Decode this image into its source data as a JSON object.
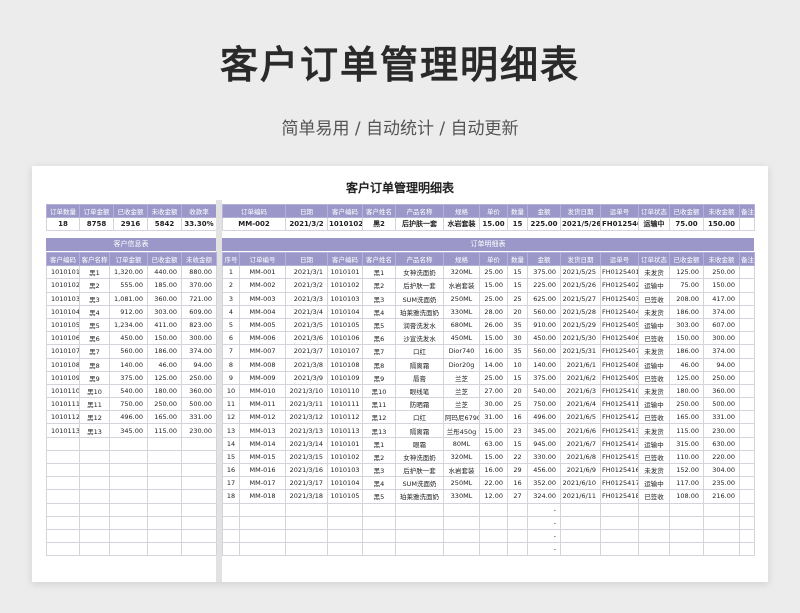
{
  "page_title": "客户订单管理明细表",
  "subtitle": "简单易用  /  自动统计  /  自动更新",
  "sheet_title": "客户订单管理明细表",
  "summary": {
    "headers": [
      "订单数量",
      "订单金额",
      "已收金额",
      "未收金额",
      "收款率"
    ],
    "values": [
      "18",
      "8758",
      "2916",
      "5842",
      "33.30%"
    ]
  },
  "search": {
    "headers": [
      "订单编码",
      "日期",
      "客户编码",
      "客户姓名",
      "产品名称",
      "规格",
      "单价",
      "数量",
      "金额",
      "发货日期",
      "运单号",
      "订单状态",
      "已收金额",
      "未收金额",
      "备注"
    ],
    "values": [
      "MM-002",
      "2021/3/2",
      "1010102",
      "黑2",
      "后护肤一套",
      "水岩套装",
      "15.00",
      "15",
      "225.00",
      "2021/5/26",
      "FH0125402",
      "运输中",
      "75.00",
      "150.00",
      ""
    ]
  },
  "customer_band": "客户信息表",
  "order_band": "订单明细表",
  "customer_headers": [
    "客户编码",
    "客户名称",
    "订单金额",
    "已收金额",
    "未收金额"
  ],
  "customers": [
    [
      "1010101",
      "黑1",
      "1,320.00",
      "440.00",
      "880.00"
    ],
    [
      "1010102",
      "黑2",
      "555.00",
      "185.00",
      "370.00"
    ],
    [
      "1010103",
      "黑3",
      "1,081.00",
      "360.00",
      "721.00"
    ],
    [
      "1010104",
      "黑4",
      "912.00",
      "303.00",
      "609.00"
    ],
    [
      "1010105",
      "黑5",
      "1,234.00",
      "411.00",
      "823.00"
    ],
    [
      "1010106",
      "黑6",
      "450.00",
      "150.00",
      "300.00"
    ],
    [
      "1010107",
      "黑7",
      "560.00",
      "186.00",
      "374.00"
    ],
    [
      "1010108",
      "黑8",
      "140.00",
      "46.00",
      "94.00"
    ],
    [
      "1010109",
      "黑9",
      "375.00",
      "125.00",
      "250.00"
    ],
    [
      "1010110",
      "黑10",
      "540.00",
      "180.00",
      "360.00"
    ],
    [
      "1010111",
      "黑11",
      "750.00",
      "250.00",
      "500.00"
    ],
    [
      "1010112",
      "黑12",
      "496.00",
      "165.00",
      "331.00"
    ],
    [
      "1010113",
      "黑13",
      "345.00",
      "115.00",
      "230.00"
    ]
  ],
  "order_headers": [
    "序号",
    "订单编号",
    "日期",
    "客户编码",
    "客户姓名",
    "产品名称",
    "规格",
    "单价",
    "数量",
    "金额",
    "发货日期",
    "运单号",
    "订单状态",
    "已收金额",
    "未收金额",
    "备注"
  ],
  "orders": [
    [
      "1",
      "MM-001",
      "2021/3/1",
      "1010101",
      "黑1",
      "女神洗面奶",
      "320ML",
      "25.00",
      "15",
      "375.00",
      "2021/5/25",
      "FH0125401",
      "未发货",
      "125.00",
      "250.00",
      ""
    ],
    [
      "2",
      "MM-002",
      "2021/3/2",
      "1010102",
      "黑2",
      "后护肤一套",
      "水岩套装",
      "15.00",
      "15",
      "225.00",
      "2021/5/26",
      "FH0125402",
      "运输中",
      "75.00",
      "150.00",
      ""
    ],
    [
      "3",
      "MM-003",
      "2021/3/3",
      "1010103",
      "黑3",
      "SUM洗面奶",
      "250ML",
      "25.00",
      "25",
      "625.00",
      "2021/5/27",
      "FH0125403",
      "已签收",
      "208.00",
      "417.00",
      ""
    ],
    [
      "4",
      "MM-004",
      "2021/3/4",
      "1010104",
      "黑4",
      "珀莱雅洗面奶",
      "330ML",
      "28.00",
      "20",
      "560.00",
      "2021/5/28",
      "FH0125404",
      "未发货",
      "186.00",
      "374.00",
      ""
    ],
    [
      "5",
      "MM-005",
      "2021/3/5",
      "1010105",
      "黑5",
      "润膏洗发水",
      "680ML",
      "26.00",
      "35",
      "910.00",
      "2021/5/29",
      "FH0125405",
      "运输中",
      "303.00",
      "607.00",
      ""
    ],
    [
      "6",
      "MM-006",
      "2021/3/6",
      "1010106",
      "黑6",
      "沙宣洗发水",
      "450ML",
      "15.00",
      "30",
      "450.00",
      "2021/5/30",
      "FH0125406",
      "已签收",
      "150.00",
      "300.00",
      ""
    ],
    [
      "7",
      "MM-007",
      "2021/3/7",
      "1010107",
      "黑7",
      "口红",
      "Dior740",
      "16.00",
      "35",
      "560.00",
      "2021/5/31",
      "FH0125407",
      "未发货",
      "186.00",
      "374.00",
      ""
    ],
    [
      "8",
      "MM-008",
      "2021/3/8",
      "1010108",
      "黑8",
      "隔离霜",
      "Dior20g",
      "14.00",
      "10",
      "140.00",
      "2021/6/1",
      "FH0125408",
      "运输中",
      "46.00",
      "94.00",
      ""
    ],
    [
      "9",
      "MM-009",
      "2021/3/9",
      "1010109",
      "黑9",
      "唇膏",
      "兰芝",
      "25.00",
      "15",
      "375.00",
      "2021/6/2",
      "FH0125409",
      "已签收",
      "125.00",
      "250.00",
      ""
    ],
    [
      "10",
      "MM-010",
      "2021/3/10",
      "1010110",
      "黑10",
      "眼线笔",
      "兰芝",
      "27.00",
      "20",
      "540.00",
      "2021/6/3",
      "FH0125410",
      "未发货",
      "180.00",
      "360.00",
      ""
    ],
    [
      "11",
      "MM-011",
      "2021/3/11",
      "1010111",
      "黑11",
      "防晒霜",
      "兰芝",
      "30.00",
      "25",
      "750.00",
      "2021/6/4",
      "FH0125411",
      "运输中",
      "250.00",
      "500.00",
      ""
    ],
    [
      "12",
      "MM-012",
      "2021/3/12",
      "1010112",
      "黑12",
      "口红",
      "阿玛尼6790",
      "31.00",
      "16",
      "496.00",
      "2021/6/5",
      "FH0125412",
      "已签收",
      "165.00",
      "331.00",
      ""
    ],
    [
      "13",
      "MM-013",
      "2021/3/13",
      "1010113",
      "黑13",
      "隔离霜",
      "兰彤450g",
      "15.00",
      "23",
      "345.00",
      "2021/6/6",
      "FH0125413",
      "未发货",
      "115.00",
      "230.00",
      ""
    ],
    [
      "14",
      "MM-014",
      "2021/3/14",
      "1010101",
      "黑1",
      "眼霜",
      "80ML",
      "63.00",
      "15",
      "945.00",
      "2021/6/7",
      "FH0125414",
      "运输中",
      "315.00",
      "630.00",
      ""
    ],
    [
      "15",
      "MM-015",
      "2021/3/15",
      "1010102",
      "黑2",
      "女神洗面奶",
      "320ML",
      "15.00",
      "22",
      "330.00",
      "2021/6/8",
      "FH0125415",
      "已签收",
      "110.00",
      "220.00",
      ""
    ],
    [
      "16",
      "MM-016",
      "2021/3/16",
      "1010103",
      "黑3",
      "后护肤一套",
      "水岩套装",
      "16.00",
      "29",
      "456.00",
      "2021/6/9",
      "FH0125416",
      "未发货",
      "152.00",
      "304.00",
      ""
    ],
    [
      "17",
      "MM-017",
      "2021/3/17",
      "1010104",
      "黑4",
      "SUM洗面奶",
      "250ML",
      "22.00",
      "16",
      "352.00",
      "2021/6/10",
      "FH0125417",
      "运输中",
      "117.00",
      "235.00",
      ""
    ],
    [
      "18",
      "MM-018",
      "2021/3/18",
      "1010105",
      "黑5",
      "珀莱雅洗面奶",
      "330ML",
      "12.00",
      "27",
      "324.00",
      "2021/6/11",
      "FH0125418",
      "已签收",
      "108.00",
      "216.00",
      ""
    ],
    [
      "",
      "",
      "",
      "",
      "",
      "",
      "",
      "",
      "",
      "-",
      "",
      "",
      "",
      "",
      "",
      ""
    ],
    [
      "",
      "",
      "",
      "",
      "",
      "",
      "",
      "",
      "",
      "-",
      "",
      "",
      "",
      "",
      "",
      ""
    ],
    [
      "",
      "",
      "",
      "",
      "",
      "",
      "",
      "",
      "",
      "-",
      "",
      "",
      "",
      "",
      "",
      ""
    ],
    [
      "",
      "",
      "",
      "",
      "",
      "",
      "",
      "",
      "",
      "-",
      "",
      "",
      "",
      "",
      "",
      ""
    ]
  ]
}
